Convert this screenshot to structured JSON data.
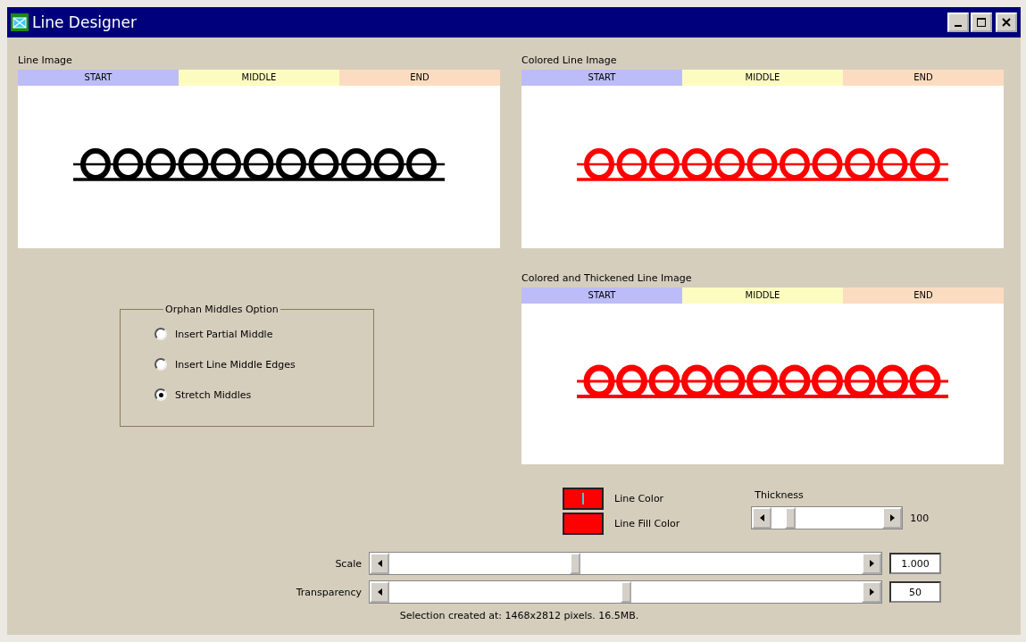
{
  "window": {
    "title": "Line Designer"
  },
  "panels": [
    {
      "title": "Line Image",
      "kind": "plain",
      "color": "#000000",
      "segments": [
        {
          "label": "START",
          "color": "#bcbcf8"
        },
        {
          "label": "MIDDLE",
          "color": "#fcfcc0"
        },
        {
          "label": "END",
          "color": "#fcdcc0"
        }
      ]
    },
    {
      "title": "Colored Line Image",
      "kind": "plain",
      "color": "#ff0000",
      "segments": [
        {
          "label": "START",
          "color": "#bcbcf8"
        },
        {
          "label": "MIDDLE",
          "color": "#fcfcc0"
        },
        {
          "label": "END",
          "color": "#fcdcc0"
        }
      ]
    },
    {
      "title": "Colored and Thickened Line Image",
      "kind": "thickened",
      "color": "#ff0000",
      "segments": [
        {
          "label": "START",
          "color": "#bcbcf8"
        },
        {
          "label": "MIDDLE",
          "color": "#fcfcc0"
        },
        {
          "label": "END",
          "color": "#fcdcc0"
        }
      ]
    }
  ],
  "orphan_middles": {
    "title": "Orphan Middles Option",
    "options": [
      {
        "label": "Insert Partial Middle",
        "selected": false
      },
      {
        "label": "Insert Line Middle Edges",
        "selected": false
      },
      {
        "label": "Stretch Middles",
        "selected": true
      }
    ]
  },
  "colors": [
    {
      "label": "Line Color",
      "color": "#ff0000",
      "focused": true
    },
    {
      "label": "Line Fill Color",
      "color": "#ff0000",
      "focused": false
    }
  ],
  "thickness": {
    "label": "Thickness",
    "level": 0.13,
    "value": "100"
  },
  "sliders": [
    {
      "label": "Scale",
      "level": 0.39,
      "value": "1.000"
    },
    {
      "label": "Transparency",
      "level": 0.5,
      "value": "50"
    }
  ],
  "status": "Selection created at: 1468x2812 pixels. 16.5MB."
}
